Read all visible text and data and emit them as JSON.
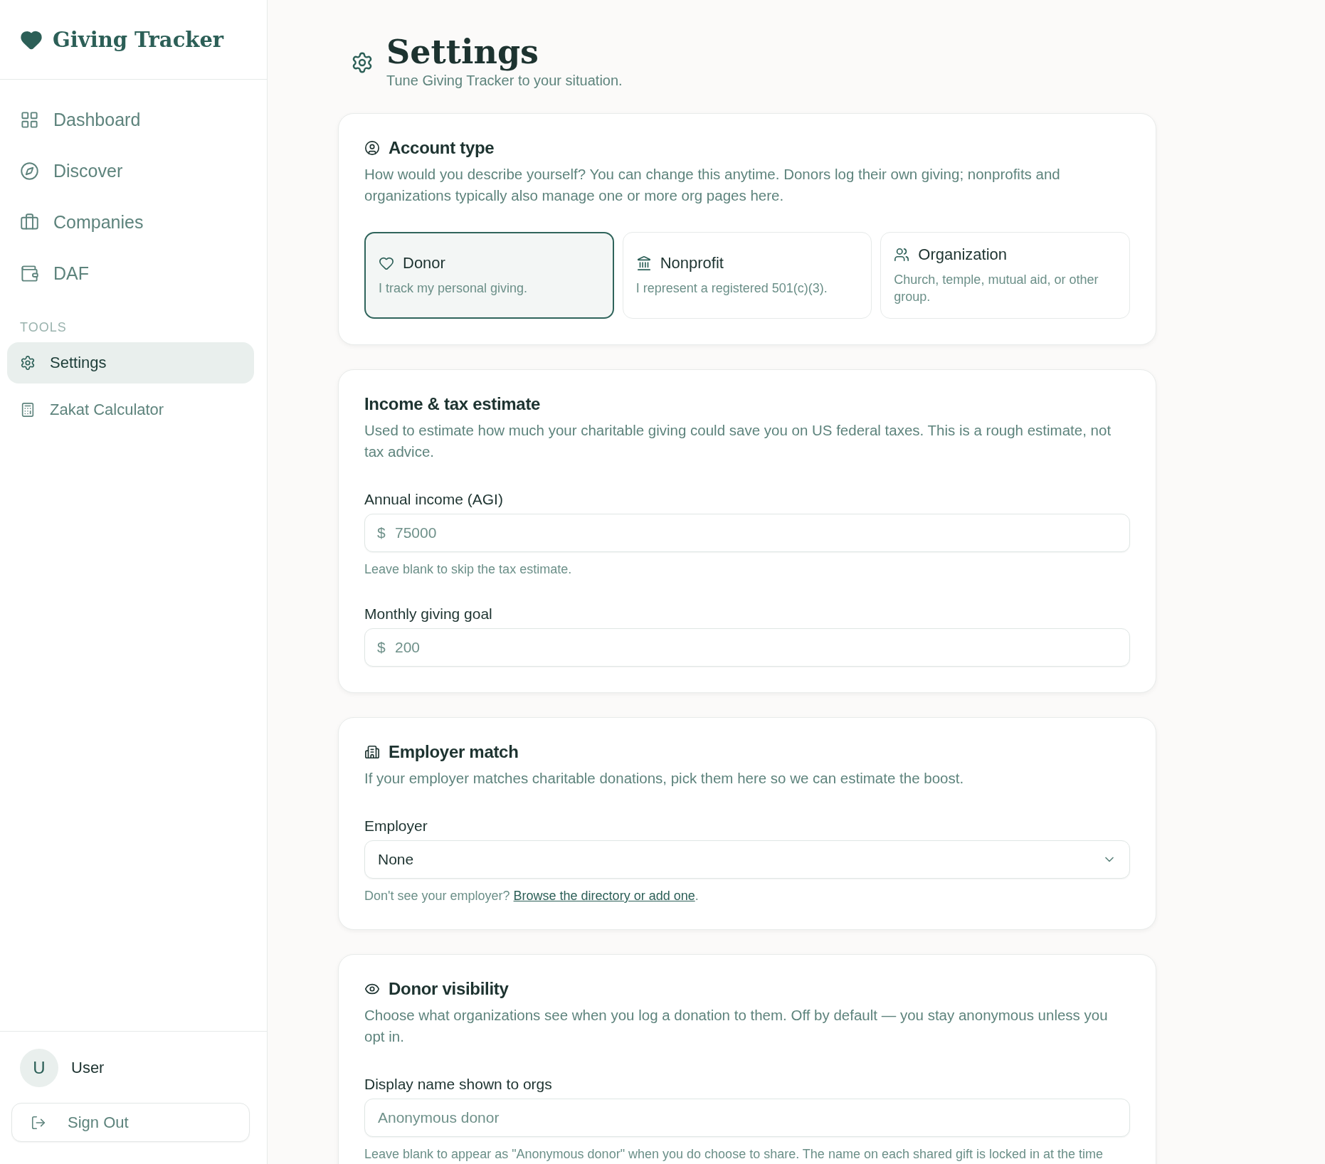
{
  "sidebar": {
    "brand": "Giving Tracker",
    "nav": [
      {
        "label": "Dashboard",
        "selected": false
      },
      {
        "label": "Discover",
        "selected": false
      },
      {
        "label": "Companies",
        "selected": false
      },
      {
        "label": "DAF",
        "selected": false
      }
    ],
    "tools_label": "TOOLS",
    "tools": [
      {
        "label": "Settings",
        "selected": true
      },
      {
        "label": "Zakat Calculator",
        "selected": false
      }
    ],
    "user": {
      "initial": "U",
      "name": "User"
    },
    "sign_out": "Sign Out"
  },
  "header": {
    "title": "Settings",
    "subtitle": "Tune Giving Tracker to your situation."
  },
  "sections": [
    {
      "kind": "account_type",
      "title": "Account type",
      "description": "How would you describe yourself? You can change this anytime. Donors log their own giving; nonprofits and organizations typically also manage one or more org pages here.",
      "options": [
        {
          "label": "Donor",
          "description": "I track my personal giving.",
          "selected": true
        },
        {
          "label": "Nonprofit",
          "description": "I represent a registered 501(c)(3).",
          "selected": false
        },
        {
          "label": "Organization",
          "description": "Church, temple, mutual aid, or other group.",
          "selected": false
        }
      ]
    },
    {
      "kind": "income",
      "title": "Income & tax estimate",
      "description": "Used to estimate how much your charitable giving could save you on US federal taxes. This is a rough estimate, not tax advice.",
      "fields": [
        {
          "label": "Annual income (AGI)",
          "prefix": "$",
          "placeholder": "75000",
          "hint": "Leave blank to skip the tax estimate."
        },
        {
          "label": "Monthly giving goal",
          "prefix": "$",
          "placeholder": "200"
        }
      ]
    },
    {
      "kind": "employer",
      "title": "Employer match",
      "description": "If your employer matches charitable donations, pick them here so we can estimate the boost.",
      "select": {
        "label": "Employer",
        "value": "None"
      },
      "hint": "Don't see your employer?",
      "link": "Browse the directory or add one",
      "hint_end": "."
    },
    {
      "kind": "visibility",
      "title": "Donor visibility",
      "description": "Choose what organizations see when you log a donation to them. Off by default — you stay anonymous unless you opt in.",
      "fields": [
        {
          "label": "Display name shown to orgs",
          "placeholder": "Anonymous donor",
          "hint": "Leave blank to appear as \"Anonymous donor\" when you do choose to share. The name on each shared gift is locked in at the time"
        }
      ]
    }
  ]
}
